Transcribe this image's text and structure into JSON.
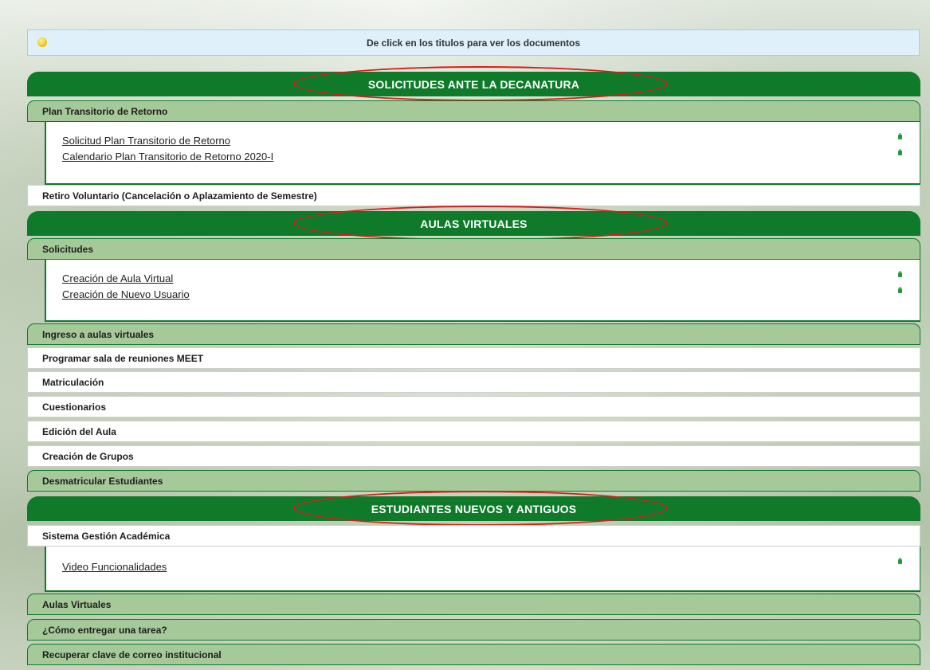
{
  "notice": {
    "text": "De click en los titulos para ver los documentos",
    "icon": "lightbulb-icon"
  },
  "sections": [
    {
      "title": "SOLICITUDES ANTE LA DECANATURA",
      "items": [
        {
          "label": "Plan Transitorio de Retorno",
          "style": "green",
          "links": [
            "Solicitud Plan Transitorio de Retorno",
            "Calendario Plan Transitorio de Retorno 2020-I"
          ]
        },
        {
          "label": "Retiro Voluntario (Cancelación o Aplazamiento de Semestre)",
          "style": "white"
        }
      ]
    },
    {
      "title": "AULAS VIRTUALES",
      "items": [
        {
          "label": "Solicitudes",
          "style": "green",
          "links": [
            "Creación de Aula Virtual",
            "Creación de Nuevo Usuario"
          ]
        },
        {
          "label": "Ingreso a aulas virtuales",
          "style": "green"
        },
        {
          "label": "Programar sala de reuniones MEET",
          "style": "white"
        },
        {
          "label": "Matriculación",
          "style": "white"
        },
        {
          "label": "Cuestionarios",
          "style": "white"
        },
        {
          "label": "Edición del Aula",
          "style": "white"
        },
        {
          "label": "Creación de Grupos",
          "style": "white"
        },
        {
          "label": "Desmatricular Estudiantes",
          "style": "green"
        }
      ]
    },
    {
      "title": "ESTUDIANTES NUEVOS Y ANTIGUOS",
      "items": [
        {
          "label": "Sistema Gestión Académica",
          "style": "white",
          "links": [
            "Video Funcionalidades"
          ]
        },
        {
          "label": "Aulas Virtuales",
          "style": "green"
        },
        {
          "label": "¿Cómo entregar una tarea?",
          "style": "green"
        },
        {
          "label": "Recuperar clave de correo institucional",
          "style": "green"
        }
      ]
    }
  ],
  "colors": {
    "header_green": "#0f7a2a",
    "accordion_green": "#a6c99a",
    "highlight_red": "#e01919",
    "notice_blue": "#dff0fb"
  }
}
